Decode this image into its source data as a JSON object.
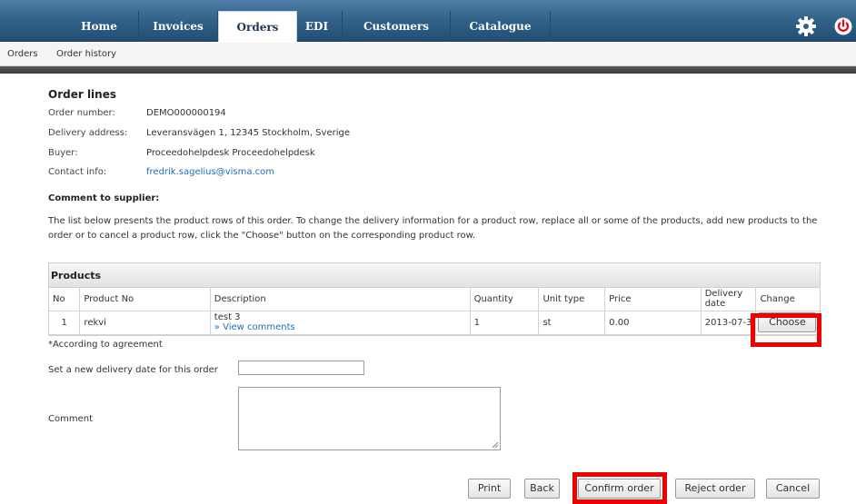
{
  "nav": {
    "tabs": [
      {
        "label": "Home",
        "active": false
      },
      {
        "label": "Invoices",
        "active": false
      },
      {
        "label": "Orders",
        "active": true
      },
      {
        "label": "EDI",
        "active": false
      },
      {
        "label": "Customers",
        "active": false
      },
      {
        "label": "Catalogue",
        "active": false
      }
    ],
    "icons": {
      "settings": "gear-icon",
      "logout": "power-icon"
    }
  },
  "subnav": {
    "items": [
      "Orders",
      "Order history"
    ]
  },
  "order": {
    "title": "Order lines",
    "fields": [
      {
        "label": "Order number:",
        "value": "DEMO000000194"
      },
      {
        "label": "Delivery address:",
        "value": "Leveransvägen 1, 12345 Stockholm, Sverige"
      },
      {
        "label": "Buyer:",
        "value": "Proceedohelpdesk Proceedohelpdesk"
      },
      {
        "label": "Contact info:",
        "value": "fredrik.sagelius@visma.com"
      }
    ],
    "comment_to_supplier_label": "Comment to supplier:",
    "info_text": "The list below presents the product rows of this order. To change the delivery information for a product row, replace all or some of the products, add new products to the order or to cancel a product row, click the \"Choose\" button on the corresponding product row."
  },
  "products": {
    "title": "Products",
    "columns": [
      "No",
      "Product No",
      "Description",
      "Quantity",
      "Unit type",
      "Price",
      "Delivery date",
      "Change"
    ],
    "rows": [
      {
        "no": "1",
        "product_no": "rekvi",
        "description": "test 3",
        "comments_link": "» View comments",
        "quantity": "1",
        "unit_type": "st",
        "price": "0.00",
        "delivery_date": "2013-07-3",
        "action_label": "Choose"
      }
    ],
    "footnote": "*According to agreement"
  },
  "form": {
    "new_date_label": "Set a new delivery date for this order",
    "new_date_value": "",
    "comment_label": "Comment",
    "comment_value": ""
  },
  "actions": {
    "print": "Print",
    "back": "Back",
    "confirm": "Confirm order",
    "reject": "Reject order",
    "cancel": "Cancel"
  },
  "colors": {
    "nav_bg": "#2f5e86",
    "link": "#1e6fb8",
    "highlight": "#ee0000",
    "power": "#e8001c"
  }
}
